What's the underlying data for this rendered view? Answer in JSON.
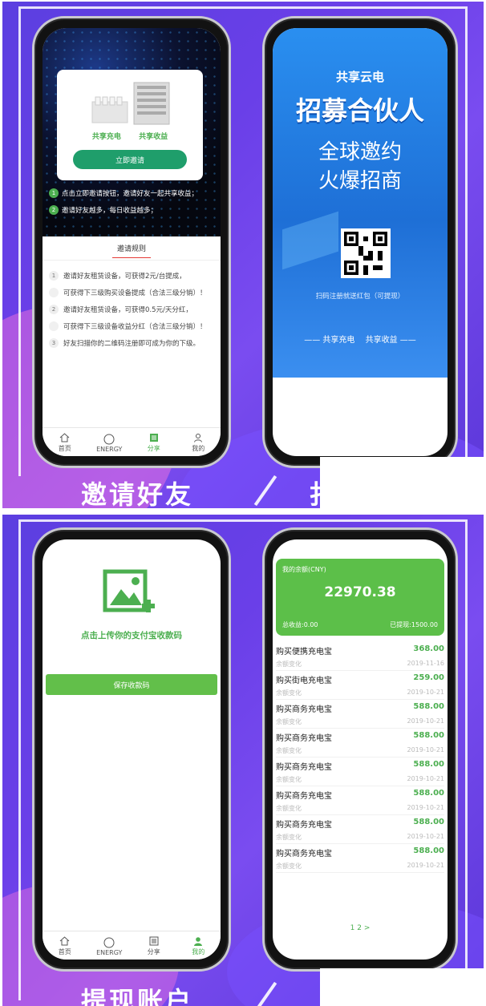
{
  "colors": {
    "purple": "#6a3fe8",
    "green": "#4caf50",
    "blue": "#2b7de0"
  },
  "top_panel": {
    "caption_left": "邀请好友",
    "caption_right": "扌",
    "invite_screen": {
      "product_left": "共享充电",
      "product_right": "共享收益",
      "invite_button": "立即邀请",
      "steps": [
        {
          "num": "1",
          "text": "点击立即邀请按钮，邀请好友一起共享收益；"
        },
        {
          "num": "2",
          "text": "邀请好友越多，每日收益越多；"
        }
      ],
      "rules_title": "邀请规则",
      "rules": [
        {
          "num": "1",
          "text": "邀请好友租赁设备，可获得2元/台提成，"
        },
        {
          "num": "",
          "text": "可获得下三级购买设备提成（合法三级分销）！"
        },
        {
          "num": "2",
          "text": "邀请好友租赁设备，可获得0.5元/天分红，"
        },
        {
          "num": "",
          "text": "可获得下三级设备收益分红（合法三级分销）！"
        },
        {
          "num": "3",
          "text": "好友扫描你的二维码注册即可成为你的下级。"
        }
      ],
      "tabs": [
        {
          "label": "首页",
          "icon": "home-icon",
          "active": false
        },
        {
          "label": "ENERGY",
          "icon": "circle-icon",
          "active": false
        },
        {
          "label": "分享",
          "icon": "share-icon",
          "active": true
        },
        {
          "label": "我的",
          "icon": "user-icon",
          "active": false
        }
      ]
    },
    "poster_screen": {
      "brand": "共享云电",
      "headline": "招募合伙人",
      "line1": "全球邀约",
      "line2": "火爆招商",
      "scan_text": "扫码注册就送红包（可提现）",
      "footer": "—— 共享充电　 共享收益 ——"
    }
  },
  "bottom_panel": {
    "caption_left": "提现账户",
    "upload_screen": {
      "upload_hint": "点击上传你的支付宝收款码",
      "save_button": "保存收款码",
      "tabs": [
        {
          "label": "首页",
          "icon": "home-icon",
          "active": false
        },
        {
          "label": "ENERGY",
          "icon": "circle-icon",
          "active": false
        },
        {
          "label": "分享",
          "icon": "share-icon",
          "active": false
        },
        {
          "label": "我的",
          "icon": "user-icon",
          "active": true
        }
      ]
    },
    "balance_screen": {
      "balance_label": "我的余额(CNY)",
      "balance": "22970.38",
      "total_income": "总收益:0.00",
      "withdrawn": "已提现:1500.00",
      "transactions": [
        {
          "title": "购买便携充电宝",
          "amount": "368.00",
          "note": "余额变化",
          "date": "2019-11-16"
        },
        {
          "title": "购买街电充电宝",
          "amount": "259.00",
          "note": "余额变化",
          "date": "2019-10-21"
        },
        {
          "title": "购买商务充电宝",
          "amount": "588.00",
          "note": "余额变化",
          "date": "2019-10-21"
        },
        {
          "title": "购买商务充电宝",
          "amount": "588.00",
          "note": "余额变化",
          "date": "2019-10-21"
        },
        {
          "title": "购买商务充电宝",
          "amount": "588.00",
          "note": "余额变化",
          "date": "2019-10-21"
        },
        {
          "title": "购买商务充电宝",
          "amount": "588.00",
          "note": "余额变化",
          "date": "2019-10-21"
        },
        {
          "title": "购买商务充电宝",
          "amount": "588.00",
          "note": "余额变化",
          "date": "2019-10-21"
        },
        {
          "title": "购买商务充电宝",
          "amount": "588.00",
          "note": "余额变化",
          "date": "2019-10-21"
        }
      ],
      "pagination": [
        "1",
        "2",
        ">"
      ]
    }
  }
}
